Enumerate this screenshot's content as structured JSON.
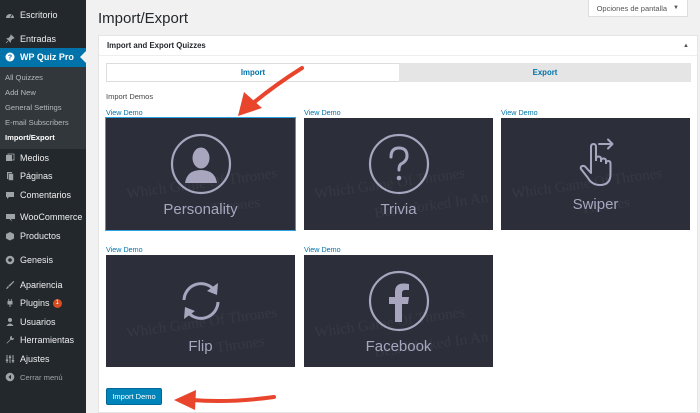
{
  "sidebar": {
    "items": [
      {
        "label": "Escritorio",
        "icon": "dashboard-icon"
      },
      {
        "label": "Entradas",
        "icon": "pin-icon"
      },
      {
        "label": "WP Quiz Pro",
        "icon": "question-icon"
      },
      {
        "label": "Medios",
        "icon": "media-icon"
      },
      {
        "label": "Páginas",
        "icon": "pages-icon"
      },
      {
        "label": "Comentarios",
        "icon": "comments-icon"
      },
      {
        "label": "WooCommerce",
        "icon": "woocommerce-icon"
      },
      {
        "label": "Productos",
        "icon": "products-icon"
      },
      {
        "label": "Genesis",
        "icon": "genesis-icon"
      },
      {
        "label": "Apariencia",
        "icon": "appearance-icon"
      },
      {
        "label": "Plugins",
        "icon": "plugins-icon",
        "badge": "1"
      },
      {
        "label": "Usuarios",
        "icon": "users-icon"
      },
      {
        "label": "Herramientas",
        "icon": "tools-icon"
      },
      {
        "label": "Ajustes",
        "icon": "settings-icon"
      }
    ],
    "submenu": [
      "All Quizzes",
      "Add New",
      "General Settings",
      "E-mail Subscribers",
      "Import/Export"
    ],
    "collapse_label": "Cerrar menú"
  },
  "header": {
    "title": "Import/Export",
    "screen_options": "Opciones de pantalla"
  },
  "postbox": {
    "title": "Import and Export Quizzes",
    "tabs": [
      "Import",
      "Export"
    ],
    "import_demos_label": "Import Demos",
    "demos": [
      {
        "link": "View Demo",
        "name": "Personality",
        "icon": "person-icon"
      },
      {
        "link": "View Demo",
        "name": "Trivia",
        "icon": "question-mark-icon"
      },
      {
        "link": "View Demo",
        "name": "Swiper",
        "icon": "swipe-hand-icon"
      },
      {
        "link": "View Demo",
        "name": "Flip",
        "icon": "refresh-arrows-icon"
      },
      {
        "link": "View Demo",
        "name": "Facebook",
        "icon": "facebook-icon"
      }
    ],
    "watermark": [
      "Thrones",
      "Which Game Of Thrones",
      "Best Worked In An"
    ],
    "import_button": "Import Demo"
  },
  "colors": {
    "sidebar_bg": "#23282d",
    "accent": "#0073aa",
    "thumb_bg": "#2c2e3a",
    "arrow": "#e8452c"
  }
}
